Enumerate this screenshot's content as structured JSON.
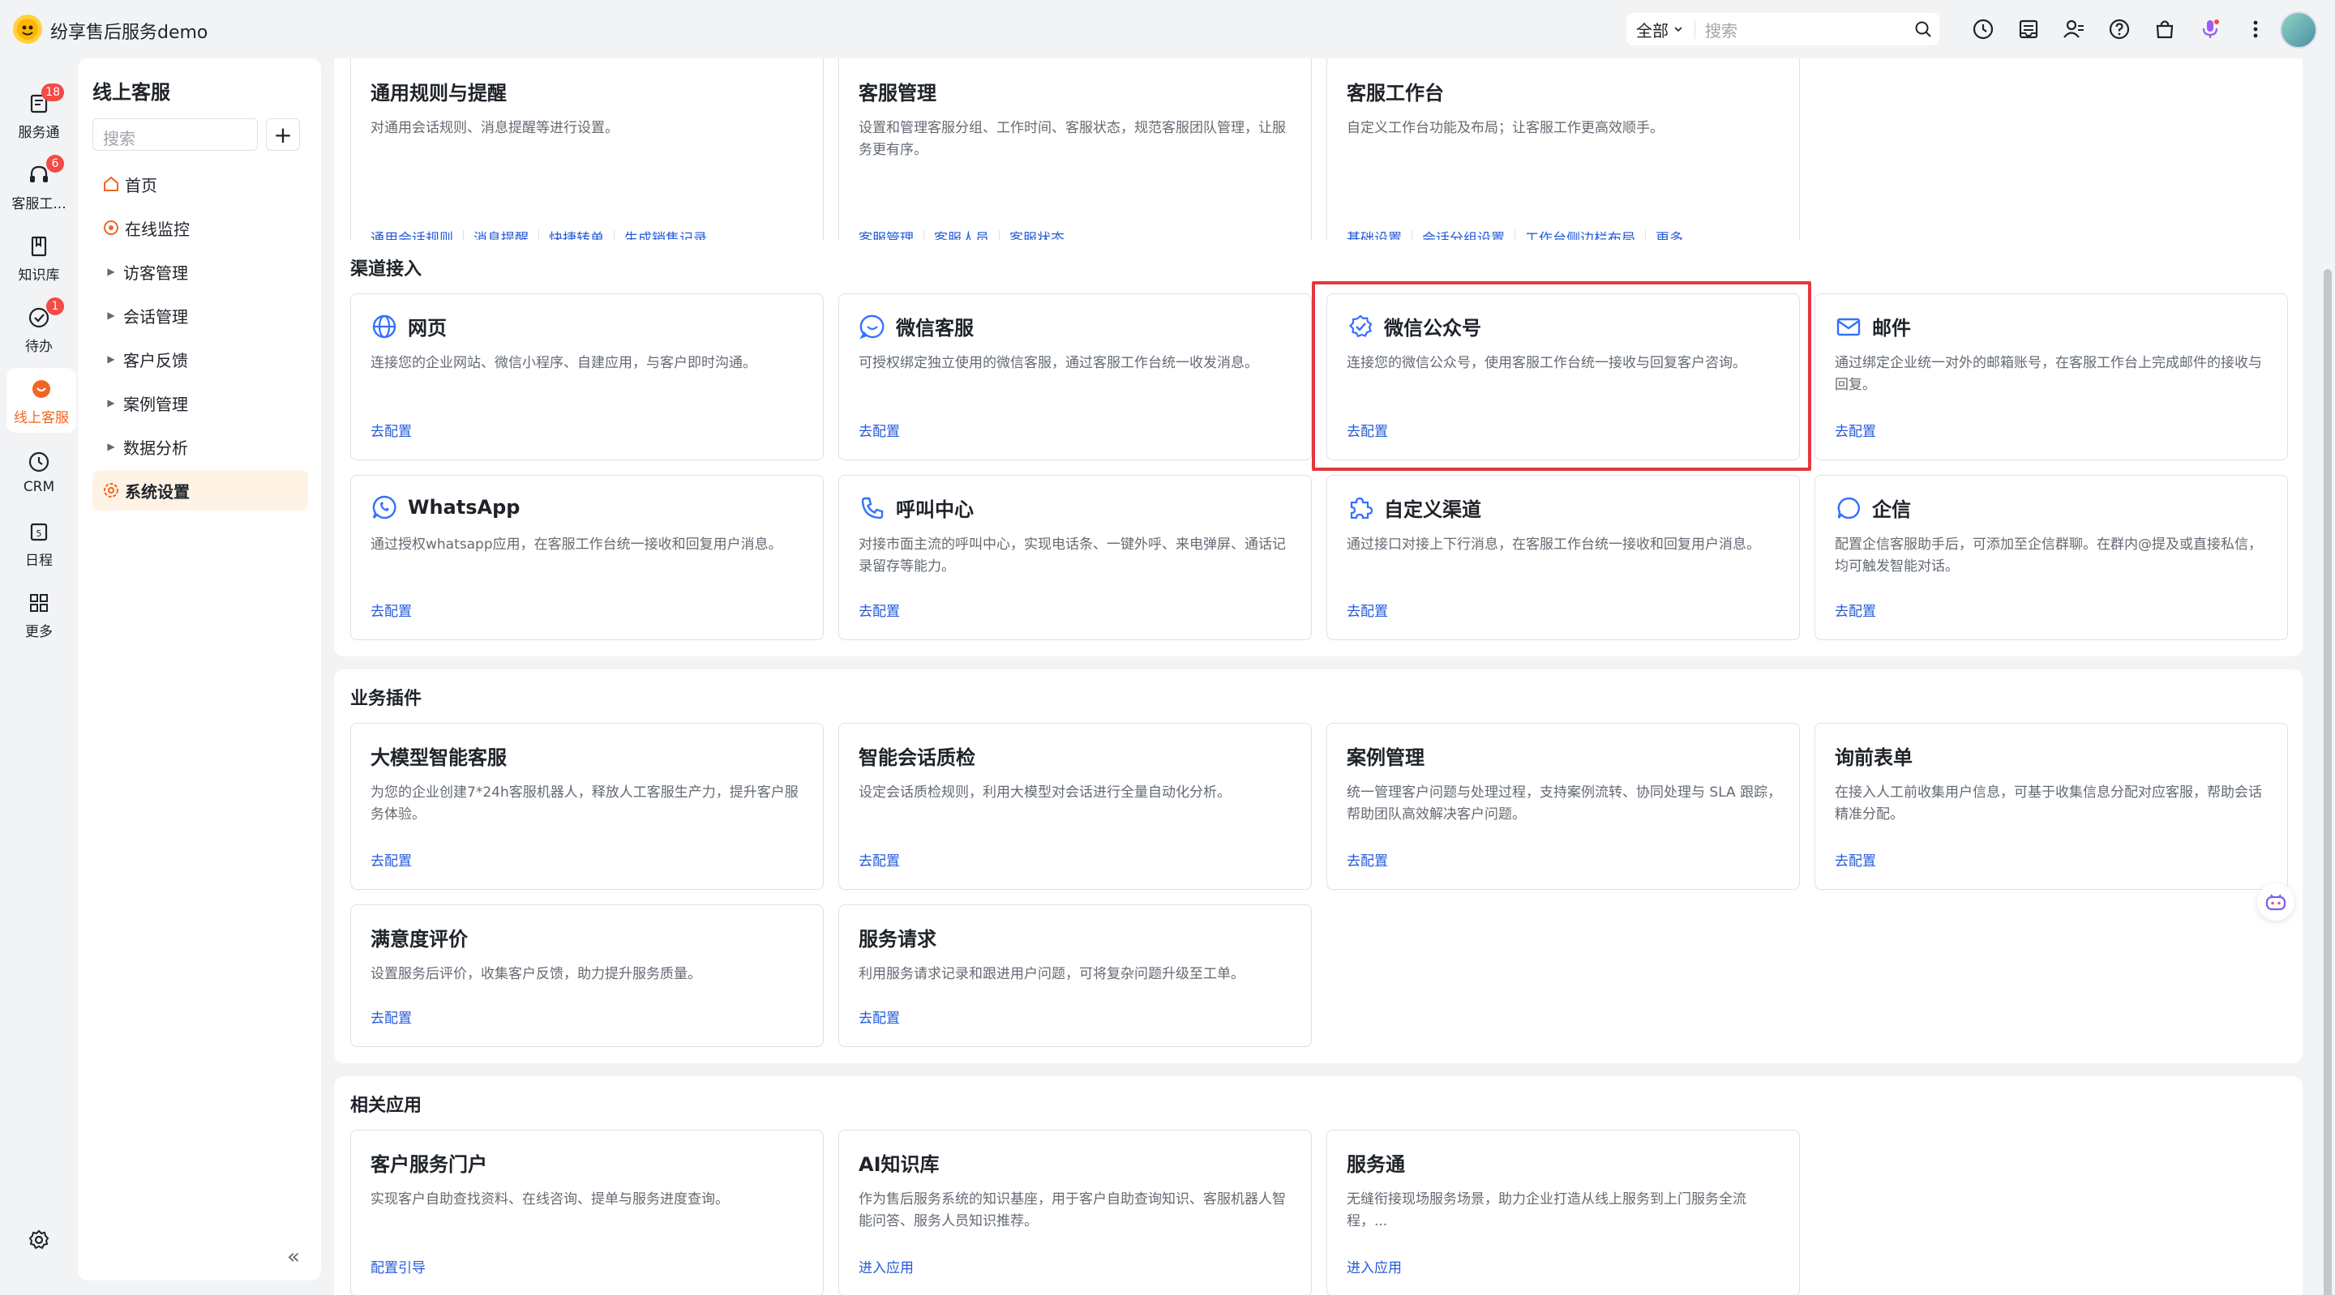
{
  "app": {
    "title": "纷享售后服务demo"
  },
  "topbar": {
    "search_scope": "全部",
    "search_placeholder": "搜索"
  },
  "rail": {
    "items": [
      {
        "label": "服务通",
        "badge": "18"
      },
      {
        "label": "客服工...",
        "badge": "6"
      },
      {
        "label": "知识库"
      },
      {
        "label": "待办",
        "badge": "1"
      },
      {
        "label": "线上客服"
      },
      {
        "label": "CRM"
      },
      {
        "label": "日程"
      },
      {
        "label": "更多"
      }
    ]
  },
  "subnav": {
    "title": "线上客服",
    "search_placeholder": "搜索",
    "items": [
      {
        "label": "首页"
      },
      {
        "label": "在线监控"
      },
      {
        "label": "访客管理"
      },
      {
        "label": "会话管理"
      },
      {
        "label": "客户反馈"
      },
      {
        "label": "案例管理"
      },
      {
        "label": "数据分析"
      },
      {
        "label": "系统设置"
      }
    ]
  },
  "top_cards": [
    {
      "title": "通用规则与提醒",
      "desc": "对通用会话规则、消息提醒等进行设置。",
      "links": [
        "通用会话规则",
        "消息提醒",
        "快捷转单",
        "生成销售记录"
      ]
    },
    {
      "title": "客服管理",
      "desc": "设置和管理客服分组、工作时间、客服状态，规范客服团队管理，让服务更有序。",
      "links": [
        "客服管理",
        "客服人员",
        "客服状态"
      ]
    },
    {
      "title": "客服工作台",
      "desc": "自定义工作台功能及布局；让客服工作更高效顺手。",
      "links": [
        "基础设置",
        "会话分组设置",
        "工作台侧边栏布局",
        "更多"
      ]
    }
  ],
  "channels": {
    "title": "渠道接入",
    "cards": [
      {
        "title": "网页",
        "desc": "连接您的企业网站、微信小程序、自建应用，与客户即时沟通。",
        "link": "去配置"
      },
      {
        "title": "微信客服",
        "desc": "可授权绑定独立使用的微信客服，通过客服工作台统一收发消息。",
        "link": "去配置"
      },
      {
        "title": "微信公众号",
        "desc": "连接您的微信公众号，使用客服工作台统一接收与回复客户咨询。",
        "link": "去配置"
      },
      {
        "title": "邮件",
        "desc": "通过绑定企业统一对外的邮箱账号，在客服工作台上完成邮件的接收与回复。",
        "link": "去配置"
      },
      {
        "title": "WhatsApp",
        "desc": "通过授权whatsapp应用，在客服工作台统一接收和回复用户消息。",
        "link": "去配置"
      },
      {
        "title": "呼叫中心",
        "desc": "对接市面主流的呼叫中心，实现电话条、一键外呼、来电弹屏、通话记录留存等能力。",
        "link": "去配置"
      },
      {
        "title": "自定义渠道",
        "desc": "通过接口对接上下行消息，在客服工作台统一接收和回复用户消息。",
        "link": "去配置"
      },
      {
        "title": "企信",
        "desc": "配置企信客服助手后，可添加至企信群聊。在群内@提及或直接私信，均可触发智能对话。",
        "link": "去配置"
      }
    ]
  },
  "plugins": {
    "title": "业务插件",
    "cards": [
      {
        "title": "大模型智能客服",
        "desc": "为您的企业创建7*24h客服机器人，释放人工客服生产力，提升客户服务体验。",
        "link": "去配置"
      },
      {
        "title": "智能会话质检",
        "desc": "设定会话质检规则，利用大模型对会话进行全量自动化分析。",
        "link": "去配置"
      },
      {
        "title": "案例管理",
        "desc": "统一管理客户问题与处理过程，支持案例流转、协同处理与 SLA 跟踪，帮助团队高效解决客户问题。",
        "link": "去配置"
      },
      {
        "title": "询前表单",
        "desc": "在接入人工前收集用户信息，可基于收集信息分配对应客服，帮助会话精准分配。",
        "link": "去配置"
      },
      {
        "title": "满意度评价",
        "desc": "设置服务后评价，收集客户反馈，助力提升服务质量。",
        "link": "去配置"
      },
      {
        "title": "服务请求",
        "desc": "利用服务请求记录和跟进用户问题，可将复杂问题升级至工单。",
        "link": "去配置"
      }
    ]
  },
  "related": {
    "title": "相关应用",
    "cards": [
      {
        "title": "客户服务门户",
        "desc": "实现客户自助查找资料、在线咨询、提单与服务进度查询。",
        "link": "配置引导"
      },
      {
        "title": "AI知识库",
        "desc": "作为售后服务系统的知识基座，用于客户自助查询知识、客服机器人智能问答、服务人员知识推荐。",
        "link": "进入应用"
      },
      {
        "title": "服务通",
        "desc": "无缝衔接现场服务场景，助力企业打造从线上服务到上门服务全流程，...",
        "link": "进入应用"
      }
    ]
  },
  "colors": {
    "accent": "#f26522",
    "link": "#245bdb",
    "highlight": "#e3393c",
    "badge": "#f54a45",
    "channel_icon": "#3370ff"
  }
}
